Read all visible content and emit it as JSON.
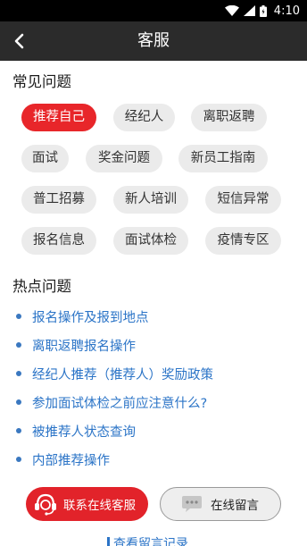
{
  "status_bar": {
    "time": "4:10",
    "icons": [
      "wifi-icon",
      "signal-icon",
      "battery-icon"
    ]
  },
  "header": {
    "title": "客服",
    "back_icon": "chevron-left-icon"
  },
  "faq": {
    "title": "常见问题",
    "chips": [
      {
        "label": "推荐自己",
        "active": true
      },
      {
        "label": "经纪人",
        "active": false
      },
      {
        "label": "离职返聘",
        "active": false
      },
      {
        "label": "面试",
        "active": false
      },
      {
        "label": "奖金问题",
        "active": false
      },
      {
        "label": "新员工指南",
        "active": false
      },
      {
        "label": "普工招募",
        "active": false
      },
      {
        "label": "新人培训",
        "active": false
      },
      {
        "label": "短信异常",
        "active": false
      },
      {
        "label": "报名信息",
        "active": false
      },
      {
        "label": "面试体检",
        "active": false
      },
      {
        "label": "疫情专区",
        "active": false
      }
    ]
  },
  "hot": {
    "title": "热点问题",
    "items": [
      "报名操作及报到地点",
      "离职返聘报名操作",
      "经纪人推荐（推荐人）奖励政策",
      "参加面试体检之前应注意什么?",
      "被推荐人状态查询",
      "内部推荐操作"
    ]
  },
  "actions": {
    "service_label": "联系在线客服",
    "message_label": "在线留言",
    "service_icon": "headset-icon",
    "message_icon": "chat-bubble-icon"
  },
  "footer": {
    "link": "查看留言记录"
  },
  "colors": {
    "accent": "#e2232a",
    "link": "#2b74c7",
    "appbar": "#2b2b2b",
    "chip_bg": "#ebebeb"
  }
}
